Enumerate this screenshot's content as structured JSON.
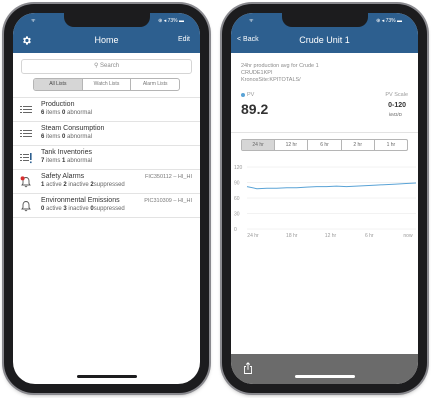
{
  "left": {
    "status": {
      "signal": "ᯤ",
      "right": "⊕ ◂ 73% ▬"
    },
    "nav": {
      "title": "Home",
      "edit": "Edit"
    },
    "search": {
      "placeholder": "Search"
    },
    "filters": [
      "All Lists",
      "Watch Lists",
      "Alarm Lists"
    ],
    "rows": [
      {
        "title": "Production",
        "n1": "6",
        "w1": "items",
        "n2": "0",
        "w2": "abnormal",
        "tag": "",
        "icon": "list-icon"
      },
      {
        "title": "Steam Consumption",
        "n1": "6",
        "w1": "items",
        "n2": "0",
        "w2": "abnormal",
        "tag": "",
        "icon": "list-icon"
      },
      {
        "title": "Tank Inventories",
        "n1": "7",
        "w1": "items",
        "n2": "1",
        "w2": "abnormal",
        "tag": "",
        "icon": "list-alert-icon"
      },
      {
        "title": "Safety Alarms",
        "n1": "1",
        "w1": "active",
        "n2": "2",
        "w2": "inactive",
        "n3": "2",
        "w3": "suppressed",
        "tag": "FIC350112 – HI_HI",
        "icon": "bell-alert-icon"
      },
      {
        "title": "Environmental Emissions",
        "n1": "0",
        "w1": "active",
        "n2": "3",
        "w2": "inactive",
        "n3": "0",
        "w3": "suppressed",
        "tag": "PIC310309 – HI_HI",
        "icon": "bell-icon"
      }
    ]
  },
  "right": {
    "status": {
      "signal": "ᯤ",
      "right": "⊕ ◂ 73% ▬"
    },
    "nav": {
      "title": "Crude Unit 1",
      "back": "< Back"
    },
    "desc": {
      "line1": "24hr production avg for Crude 1",
      "line2": "CRUDE1KPI",
      "line3": "KronosSite:KPITOTALS/"
    },
    "pv": {
      "label": "PV",
      "value": "89.2",
      "scale_label": "PV Scale",
      "scale_value": "0-120",
      "unit": "kM3/D"
    },
    "tabs": [
      "24 hr",
      "12 hr",
      "6 hr",
      "2 hr",
      "1 hr"
    ],
    "chart_data": {
      "type": "line",
      "x": [
        "24 hr",
        "18 hr",
        "12 hr",
        "6 hr",
        "now"
      ],
      "ylim": [
        0,
        120
      ],
      "yticks": [
        "120",
        "90",
        "60",
        "30",
        "0"
      ],
      "xticks": [
        "24 hr",
        "18 hr",
        "12 hr",
        "6 hr",
        "now"
      ],
      "series": [
        {
          "values": [
            82,
            78,
            79,
            79,
            80,
            80,
            81,
            82,
            82,
            83,
            82,
            83,
            84,
            85,
            86,
            87,
            88,
            89
          ]
        }
      ],
      "color": "#5aa3d6"
    }
  }
}
